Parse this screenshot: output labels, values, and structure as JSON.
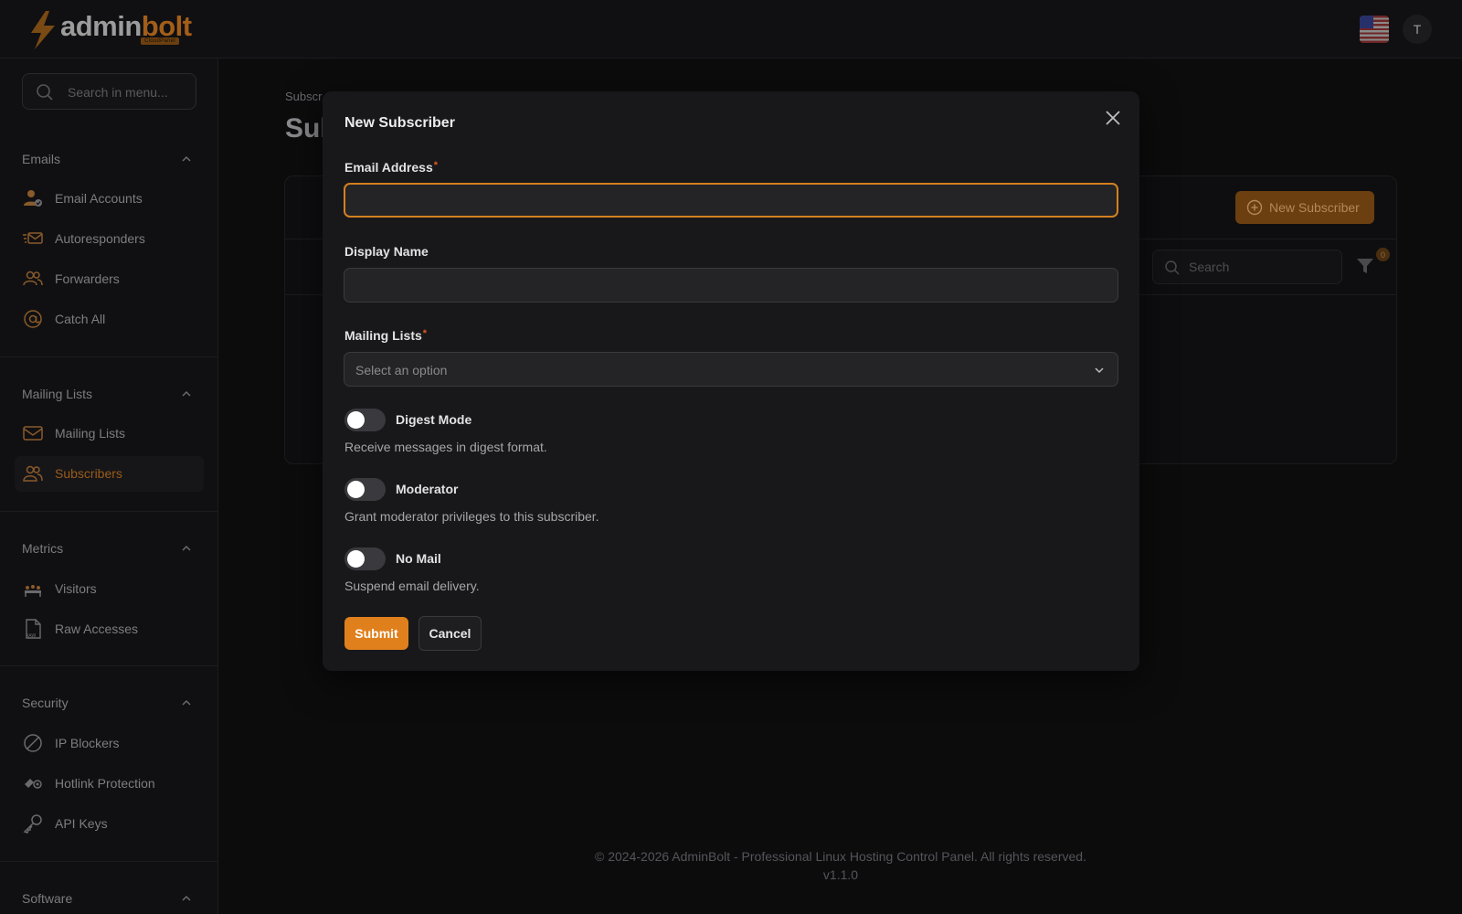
{
  "header": {
    "logo_admin": "admin",
    "logo_bolt": "bolt",
    "logo_sub": "CloudPanel",
    "avatar_initial": "T",
    "flag_icon": "us-flag-icon"
  },
  "sidebar": {
    "search_placeholder": "Search in menu...",
    "groups": [
      {
        "title": "Emails",
        "items": [
          {
            "label": "Email Accounts",
            "icon": "user-check-icon"
          },
          {
            "label": "Autoresponders",
            "icon": "mail-fast-icon"
          },
          {
            "label": "Forwarders",
            "icon": "users-icon"
          },
          {
            "label": "Catch All",
            "icon": "at-icon"
          }
        ]
      },
      {
        "title": "Mailing Lists",
        "items": [
          {
            "label": "Mailing Lists",
            "icon": "envelope-icon"
          },
          {
            "label": "Subscribers",
            "icon": "users-icon",
            "active": true
          }
        ]
      },
      {
        "title": "Metrics",
        "items": [
          {
            "label": "Visitors",
            "icon": "visitors-icon"
          },
          {
            "label": "Raw Accesses",
            "icon": "raw-file-icon"
          }
        ]
      },
      {
        "title": "Security",
        "items": [
          {
            "label": "IP Blockers",
            "icon": "block-icon"
          },
          {
            "label": "Hotlink Protection",
            "icon": "hotlink-icon"
          },
          {
            "label": "API Keys",
            "icon": "key-icon"
          }
        ]
      },
      {
        "title": "Software",
        "items": []
      }
    ]
  },
  "page": {
    "breadcrumb": "Subscr",
    "title": "Sul",
    "new_button": "New Subscriber",
    "search_placeholder": "Search",
    "filter_count": "0"
  },
  "modal": {
    "title": "New Subscriber",
    "email_label": "Email Address",
    "email_value": "",
    "display_label": "Display Name",
    "display_value": "",
    "lists_label": "Mailing Lists",
    "lists_placeholder": "Select an option",
    "required_mark": "*",
    "toggles": [
      {
        "label": "Digest Mode",
        "help": "Receive messages in digest format.",
        "on": false
      },
      {
        "label": "Moderator",
        "help": "Grant moderator privileges to this subscriber.",
        "on": false
      },
      {
        "label": "No Mail",
        "help": "Suspend email delivery.",
        "on": false
      }
    ],
    "submit": "Submit",
    "cancel": "Cancel"
  },
  "footer": {
    "copyright": "© 2024-2026 AdminBolt - Professional Linux Hosting Control Panel. All rights reserved.",
    "version": "v1.1.0"
  },
  "colors": {
    "accent": "#e0801d",
    "required": "#e2571d",
    "modal_bg": "#18181b",
    "page_bg": "#0c0c0d"
  }
}
